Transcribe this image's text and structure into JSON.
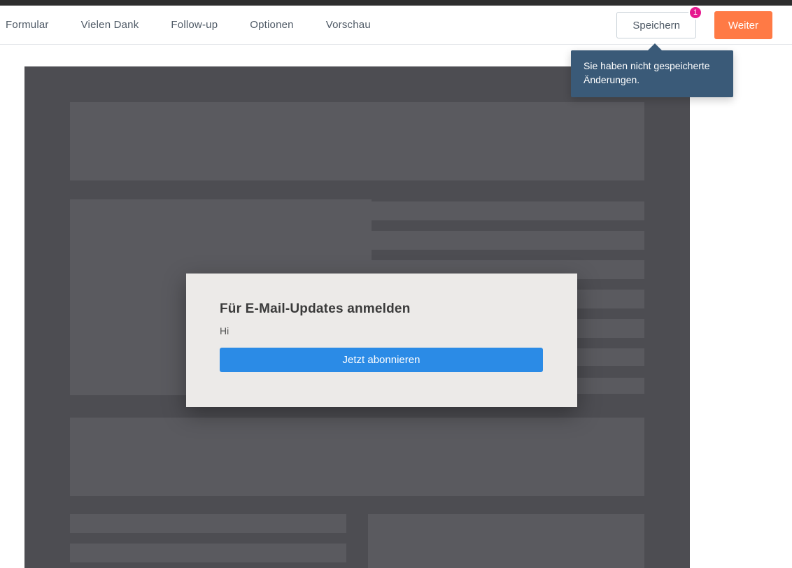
{
  "tabs": {
    "formular": "Formular",
    "vielen_dank": "Vielen Dank",
    "followup": "Follow-up",
    "optionen": "Optionen",
    "vorschau": "Vorschau"
  },
  "actions": {
    "save": "Speichern",
    "next": "Weiter",
    "badge": "1"
  },
  "tooltip": {
    "text": "Sie haben nicht gespeicherte Änderungen."
  },
  "form": {
    "title": "Für E-Mail-Updates anmelden",
    "greeting": "Hi",
    "submit": "Jetzt abonnieren"
  }
}
